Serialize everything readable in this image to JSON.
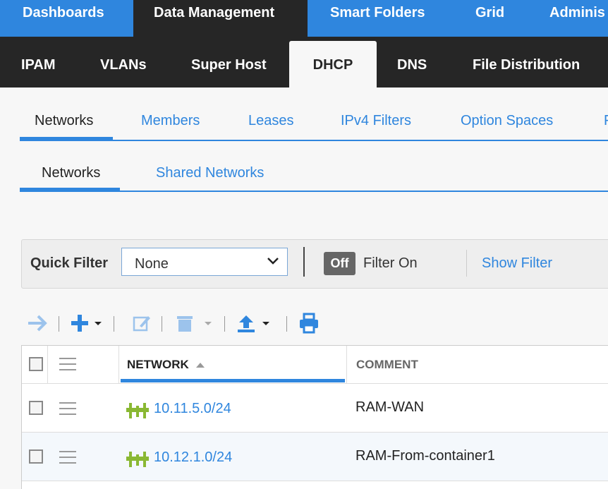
{
  "top_nav": {
    "items": [
      {
        "label": "Dashboards"
      },
      {
        "label": "Data Management"
      },
      {
        "label": "Smart Folders"
      },
      {
        "label": "Grid"
      },
      {
        "label": "Adminis"
      }
    ]
  },
  "sec_nav": {
    "items": [
      {
        "label": "IPAM"
      },
      {
        "label": "VLANs"
      },
      {
        "label": "Super Host"
      },
      {
        "label": "DHCP"
      },
      {
        "label": "DNS"
      },
      {
        "label": "File Distribution"
      }
    ]
  },
  "dhcp_tabs": {
    "items": [
      {
        "label": "Networks"
      },
      {
        "label": "Members"
      },
      {
        "label": "Leases"
      },
      {
        "label": "IPv4 Filters"
      },
      {
        "label": "Option Spaces"
      },
      {
        "label": "F"
      }
    ]
  },
  "network_tabs": {
    "items": [
      {
        "label": "Networks"
      },
      {
        "label": "Shared Networks"
      }
    ]
  },
  "filter_bar": {
    "quick_filter_label": "Quick Filter",
    "quick_filter_value": "None",
    "toggle_label": "Off",
    "filter_on_label": "Filter On",
    "show_filter_label": "Show Filter"
  },
  "grid": {
    "columns": {
      "network": "NETWORK",
      "comment": "COMMENT"
    },
    "rows": [
      {
        "network": "10.11.5.0/24",
        "comment": "RAM-WAN"
      },
      {
        "network": "10.12.1.0/24",
        "comment": "RAM-From-container1"
      }
    ]
  },
  "colors": {
    "accent": "#2f86de",
    "dark_nav": "#262626",
    "network_icon": "#8ab833"
  }
}
